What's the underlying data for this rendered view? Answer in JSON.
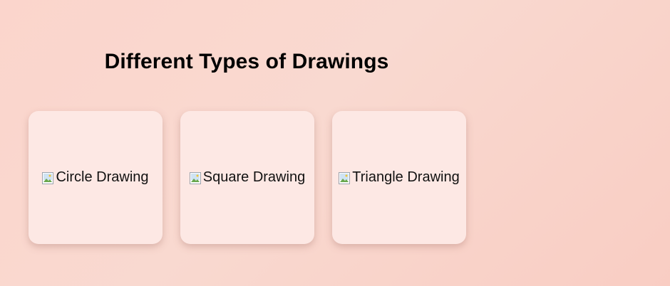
{
  "page": {
    "title": "Different Types of Drawings"
  },
  "cards": [
    {
      "alt": "Circle Drawing",
      "icon": "broken-image-icon"
    },
    {
      "alt": "Square Drawing",
      "icon": "broken-image-icon"
    },
    {
      "alt": "Triangle Drawing",
      "icon": "broken-image-icon"
    }
  ],
  "colors": {
    "background": "#f9d2c8",
    "card": "#fde8e4",
    "text": "#000000"
  }
}
